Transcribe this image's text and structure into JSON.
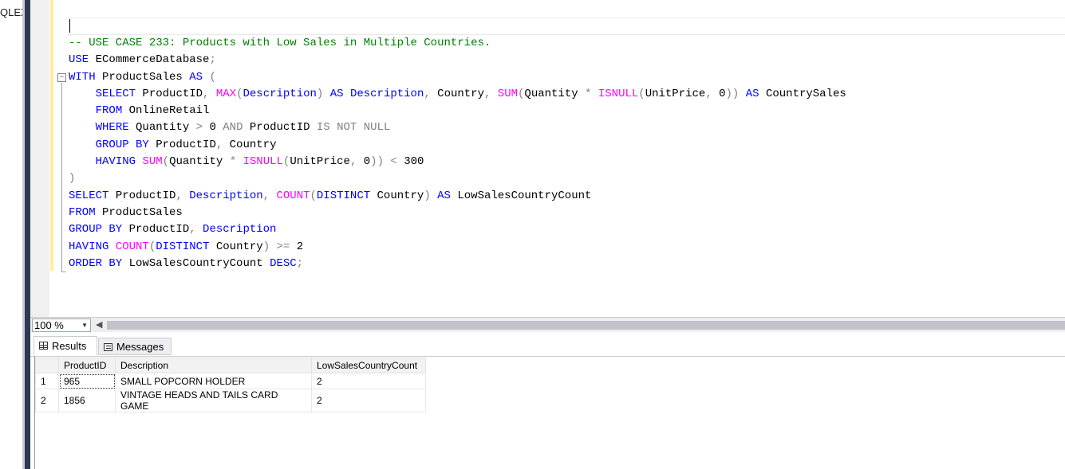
{
  "object_explorer": {
    "partial_label": "QLEX"
  },
  "editor": {
    "lines": [
      {
        "text": ""
      },
      {
        "tokens": [
          [
            "cm",
            "-- USE CASE 233: Products with Low Sales in Multiple Countries."
          ]
        ]
      },
      {
        "tokens": [
          [
            "kw",
            "USE"
          ],
          [
            "id",
            " ECommerceDatabase"
          ],
          [
            "op",
            ";"
          ]
        ]
      },
      {
        "tokens": [
          [
            "kw",
            "WITH"
          ],
          [
            "id",
            " ProductSales "
          ],
          [
            "kw",
            "AS"
          ],
          [
            "op",
            " ("
          ]
        ]
      },
      {
        "tokens": [
          [
            "id",
            "    "
          ],
          [
            "kw",
            "SELECT"
          ],
          [
            "id",
            " ProductID"
          ],
          [
            "op",
            ", "
          ],
          [
            "fn",
            "MAX"
          ],
          [
            "op",
            "("
          ],
          [
            "kw",
            "Description"
          ],
          [
            "op",
            ") "
          ],
          [
            "kw",
            "AS"
          ],
          [
            "id",
            " "
          ],
          [
            "kw",
            "Description"
          ],
          [
            "op",
            ", "
          ],
          [
            "id",
            "Country"
          ],
          [
            "op",
            ", "
          ],
          [
            "fn",
            "SUM"
          ],
          [
            "op",
            "("
          ],
          [
            "id",
            "Quantity "
          ],
          [
            "op",
            "*"
          ],
          [
            "id",
            " "
          ],
          [
            "fn",
            "ISNULL"
          ],
          [
            "op",
            "("
          ],
          [
            "id",
            "UnitPrice"
          ],
          [
            "op",
            ", "
          ],
          [
            "num",
            "0"
          ],
          [
            "op",
            "))"
          ],
          [
            "id",
            " "
          ],
          [
            "kw",
            "AS"
          ],
          [
            "id",
            " CountrySales"
          ]
        ]
      },
      {
        "tokens": [
          [
            "id",
            "    "
          ],
          [
            "kw",
            "FROM"
          ],
          [
            "id",
            " OnlineRetail"
          ]
        ]
      },
      {
        "tokens": [
          [
            "id",
            "    "
          ],
          [
            "kw",
            "WHERE"
          ],
          [
            "id",
            " Quantity "
          ],
          [
            "op",
            ">"
          ],
          [
            "num",
            " 0 "
          ],
          [
            "op",
            "AND"
          ],
          [
            "id",
            " ProductID "
          ],
          [
            "op",
            "IS NOT NULL"
          ]
        ]
      },
      {
        "tokens": [
          [
            "id",
            "    "
          ],
          [
            "kw",
            "GROUP BY"
          ],
          [
            "id",
            " ProductID"
          ],
          [
            "op",
            ", "
          ],
          [
            "id",
            "Country"
          ]
        ]
      },
      {
        "tokens": [
          [
            "id",
            "    "
          ],
          [
            "kw",
            "HAVING"
          ],
          [
            "id",
            " "
          ],
          [
            "fn",
            "SUM"
          ],
          [
            "op",
            "("
          ],
          [
            "id",
            "Quantity "
          ],
          [
            "op",
            "*"
          ],
          [
            "id",
            " "
          ],
          [
            "fn",
            "ISNULL"
          ],
          [
            "op",
            "("
          ],
          [
            "id",
            "UnitPrice"
          ],
          [
            "op",
            ", "
          ],
          [
            "num",
            "0"
          ],
          [
            "op",
            "))"
          ],
          [
            "id",
            " "
          ],
          [
            "op",
            "<"
          ],
          [
            "num",
            " 300"
          ]
        ]
      },
      {
        "tokens": [
          [
            "op",
            ")"
          ]
        ]
      },
      {
        "tokens": [
          [
            "kw",
            "SELECT"
          ],
          [
            "id",
            " ProductID"
          ],
          [
            "op",
            ", "
          ],
          [
            "kw",
            "Description"
          ],
          [
            "op",
            ", "
          ],
          [
            "fn",
            "COUNT"
          ],
          [
            "op",
            "("
          ],
          [
            "kw",
            "DISTINCT"
          ],
          [
            "id",
            " Country"
          ],
          [
            "op",
            ") "
          ],
          [
            "kw",
            "AS"
          ],
          [
            "id",
            " LowSalesCountryCount"
          ]
        ]
      },
      {
        "tokens": [
          [
            "kw",
            "FROM"
          ],
          [
            "id",
            " ProductSales"
          ]
        ]
      },
      {
        "tokens": [
          [
            "kw",
            "GROUP BY"
          ],
          [
            "id",
            " ProductID"
          ],
          [
            "op",
            ", "
          ],
          [
            "kw",
            "Description"
          ]
        ]
      },
      {
        "tokens": [
          [
            "kw",
            "HAVING"
          ],
          [
            "id",
            " "
          ],
          [
            "fn",
            "COUNT"
          ],
          [
            "op",
            "("
          ],
          [
            "kw",
            "DISTINCT"
          ],
          [
            "id",
            " Country"
          ],
          [
            "op",
            ") >="
          ],
          [
            "num",
            " 2"
          ]
        ]
      },
      {
        "tokens": [
          [
            "kw",
            "ORDER BY"
          ],
          [
            "id",
            " LowSalesCountryCount "
          ],
          [
            "kw",
            "DESC"
          ],
          [
            "op",
            ";"
          ]
        ]
      }
    ]
  },
  "zoom": {
    "value": "100 %"
  },
  "tabs": {
    "results": "Results",
    "messages": "Messages"
  },
  "results": {
    "columns": [
      "ProductID",
      "Description",
      "LowSalesCountryCount"
    ],
    "rows": [
      {
        "n": "1",
        "cells": [
          "965",
          "SMALL POPCORN HOLDER",
          "2"
        ]
      },
      {
        "n": "2",
        "cells": [
          "1856",
          "VINTAGE HEADS AND TAILS CARD GAME",
          "2"
        ]
      }
    ]
  }
}
